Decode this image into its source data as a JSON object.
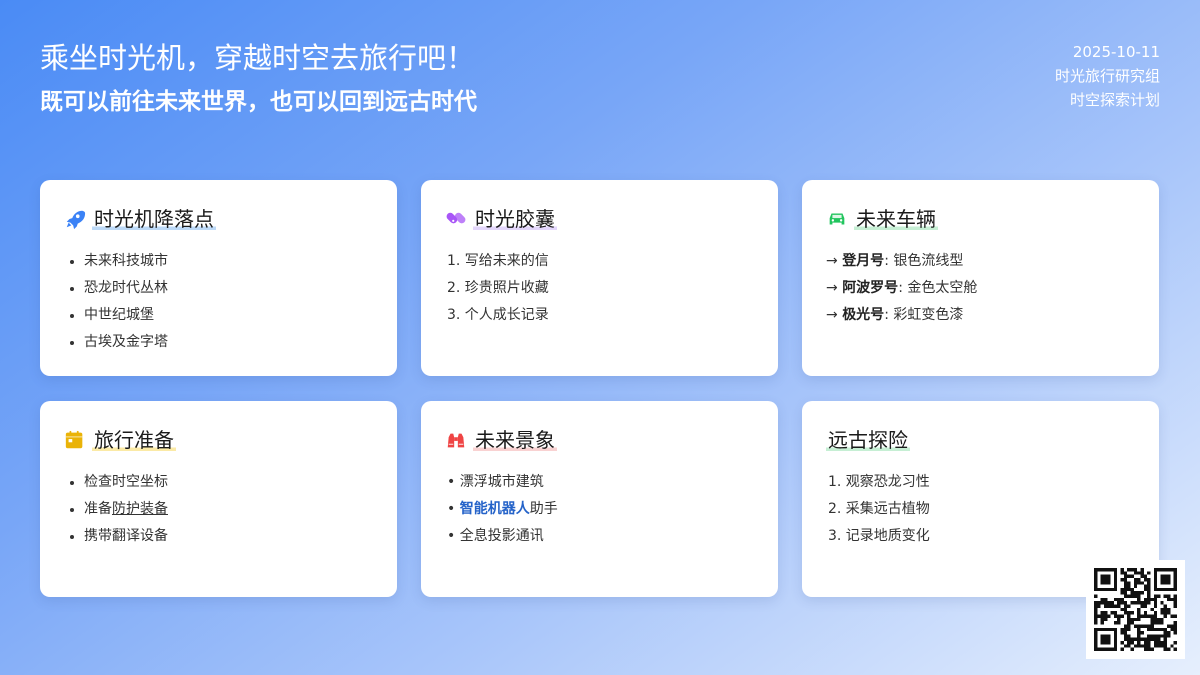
{
  "header": {
    "title": "乘坐时光机，穿越时空去旅行吧！",
    "subtitle": "既可以前往未来世界，也可以回到远古时代",
    "date": "2025-10-11",
    "org": "时光旅行研究组",
    "project": "时空探索计划"
  },
  "cards": {
    "landing": {
      "title": "时光机降落点",
      "icon": "rocket-icon",
      "highlight": "#bcd9f7",
      "items": [
        "未来科技城市",
        "恐龙时代丛林",
        "中世纪城堡",
        "古埃及金字塔"
      ]
    },
    "capsule": {
      "title": "时光胶囊",
      "icon": "capsules-icon",
      "highlight": "#e3d6fb",
      "items": [
        "1. 写给未来的信",
        "2. 珍贵照片收藏",
        "3. 个人成长记录"
      ]
    },
    "vehicles": {
      "title": "未来车辆",
      "icon": "car-icon",
      "highlight": "#c6efd4",
      "items": [
        {
          "arrow": "→",
          "name": "登月号",
          "desc": ": 银色流线型"
        },
        {
          "arrow": "→",
          "name": "阿波罗号",
          "desc": ": 金色太空舱"
        },
        {
          "arrow": "→",
          "name": "极光号",
          "desc": ": 彩虹变色漆"
        }
      ]
    },
    "prep": {
      "title": "旅行准备",
      "icon": "calendar-icon",
      "highlight": "#fbeaa6",
      "items": [
        {
          "text": "检查时空坐标"
        },
        {
          "prefix": "准备",
          "underlined": "防护装备"
        },
        {
          "text": "携带翻译设备"
        }
      ]
    },
    "scenes": {
      "title": "未来景象",
      "icon": "binoculars-icon",
      "highlight": "#f9d2d2",
      "items": [
        {
          "bullet": "•",
          "text": "漂浮城市建筑"
        },
        {
          "bullet": "•",
          "highlight": "智能机器人",
          "suffix": "助手"
        },
        {
          "bullet": "•",
          "text": "全息投影通讯"
        }
      ]
    },
    "ancient": {
      "title": "远古探险",
      "highlight": "#c6efd4",
      "items": [
        "1. 观察恐龙习性",
        "2. 采集远古植物",
        "3. 记录地质变化"
      ]
    }
  },
  "colors": {
    "rocket": "#3b82f6",
    "capsules": "#a855f7",
    "car": "#22c55e",
    "calendar": "#eab308",
    "binoculars": "#ef4444",
    "accent_blue": "#2563c9"
  },
  "qr_code": {
    "icon": "qr-code-icon"
  }
}
